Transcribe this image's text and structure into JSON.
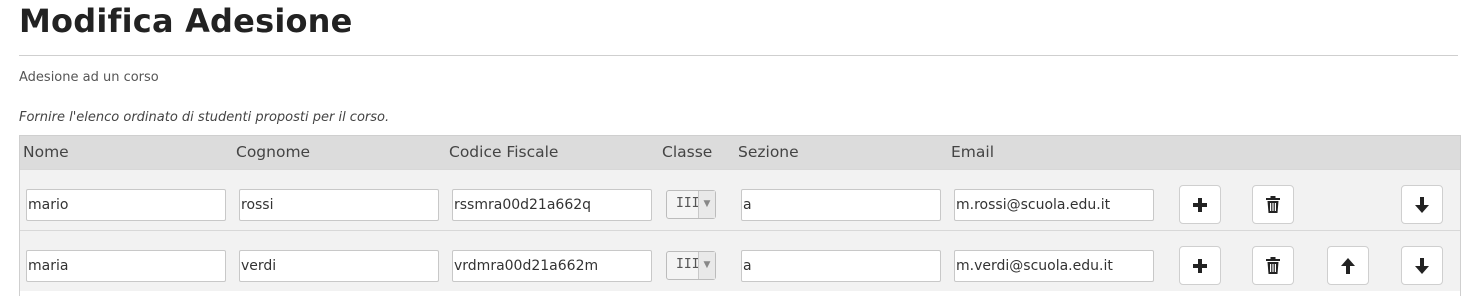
{
  "page": {
    "title": "Modifica Adesione",
    "subtitle": "Adesione ad un corso",
    "hint": "Fornire l'elenco ordinato di studenti proposti per il corso."
  },
  "table": {
    "headers": [
      "Nome",
      "Cognome",
      "Codice Fiscale",
      "Classe",
      "Sezione",
      "Email"
    ],
    "rows": [
      {
        "nome": "mario",
        "cognome": "rossi",
        "codice_fiscale": "rssmra00d21a662q",
        "classe": "III",
        "sezione": "a",
        "email": "m.rossi@scuola.edu.it",
        "actions": [
          "add-icon",
          "trash-icon",
          "arrow-down-icon"
        ]
      },
      {
        "nome": "maria",
        "cognome": "verdi",
        "codice_fiscale": "vrdmra00d21a662m",
        "classe": "III",
        "sezione": "a",
        "email": "m.verdi@scuola.edu.it",
        "actions": [
          "add-icon",
          "trash-icon",
          "arrow-up-icon",
          "arrow-down-icon"
        ]
      }
    ]
  },
  "colors": {
    "header_bg": "#dcdcdc",
    "row_bg": "#f2f2f2",
    "icon": "#222222"
  }
}
